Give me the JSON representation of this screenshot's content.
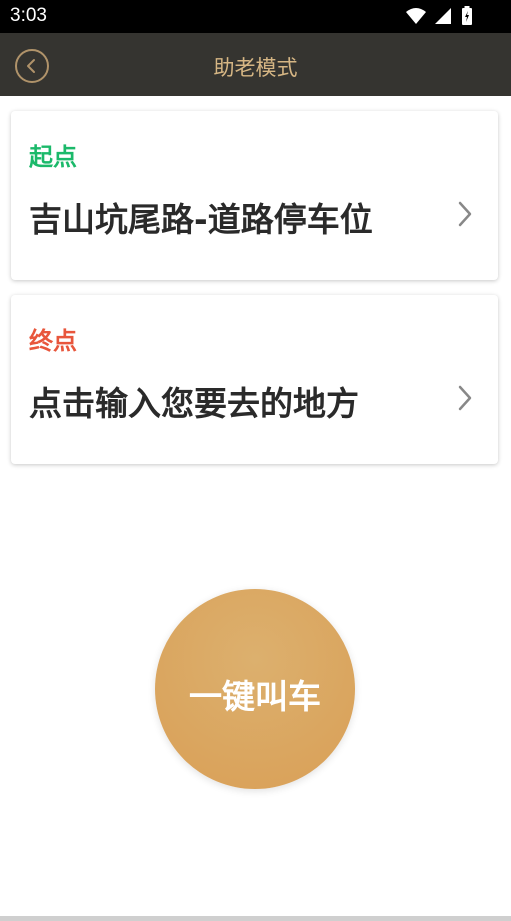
{
  "status_bar": {
    "time": "3:03"
  },
  "nav": {
    "title": "助老模式"
  },
  "start": {
    "label": "起点",
    "value": "吉山坑尾路-道路停车位"
  },
  "end": {
    "label": "终点",
    "value": "点击输入您要去的地方"
  },
  "call_button": {
    "label": "一键叫车"
  },
  "colors": {
    "nav_bg": "#353430",
    "nav_title": "#d6b684",
    "start_label": "#1bb96a",
    "end_label": "#e8563c",
    "call_button": "#d9a45e"
  },
  "icons": {
    "status": [
      "wifi-icon",
      "signal-icon",
      "battery-icon"
    ],
    "back": "back-chevron-icon",
    "chevron": "chevron-right-icon"
  }
}
